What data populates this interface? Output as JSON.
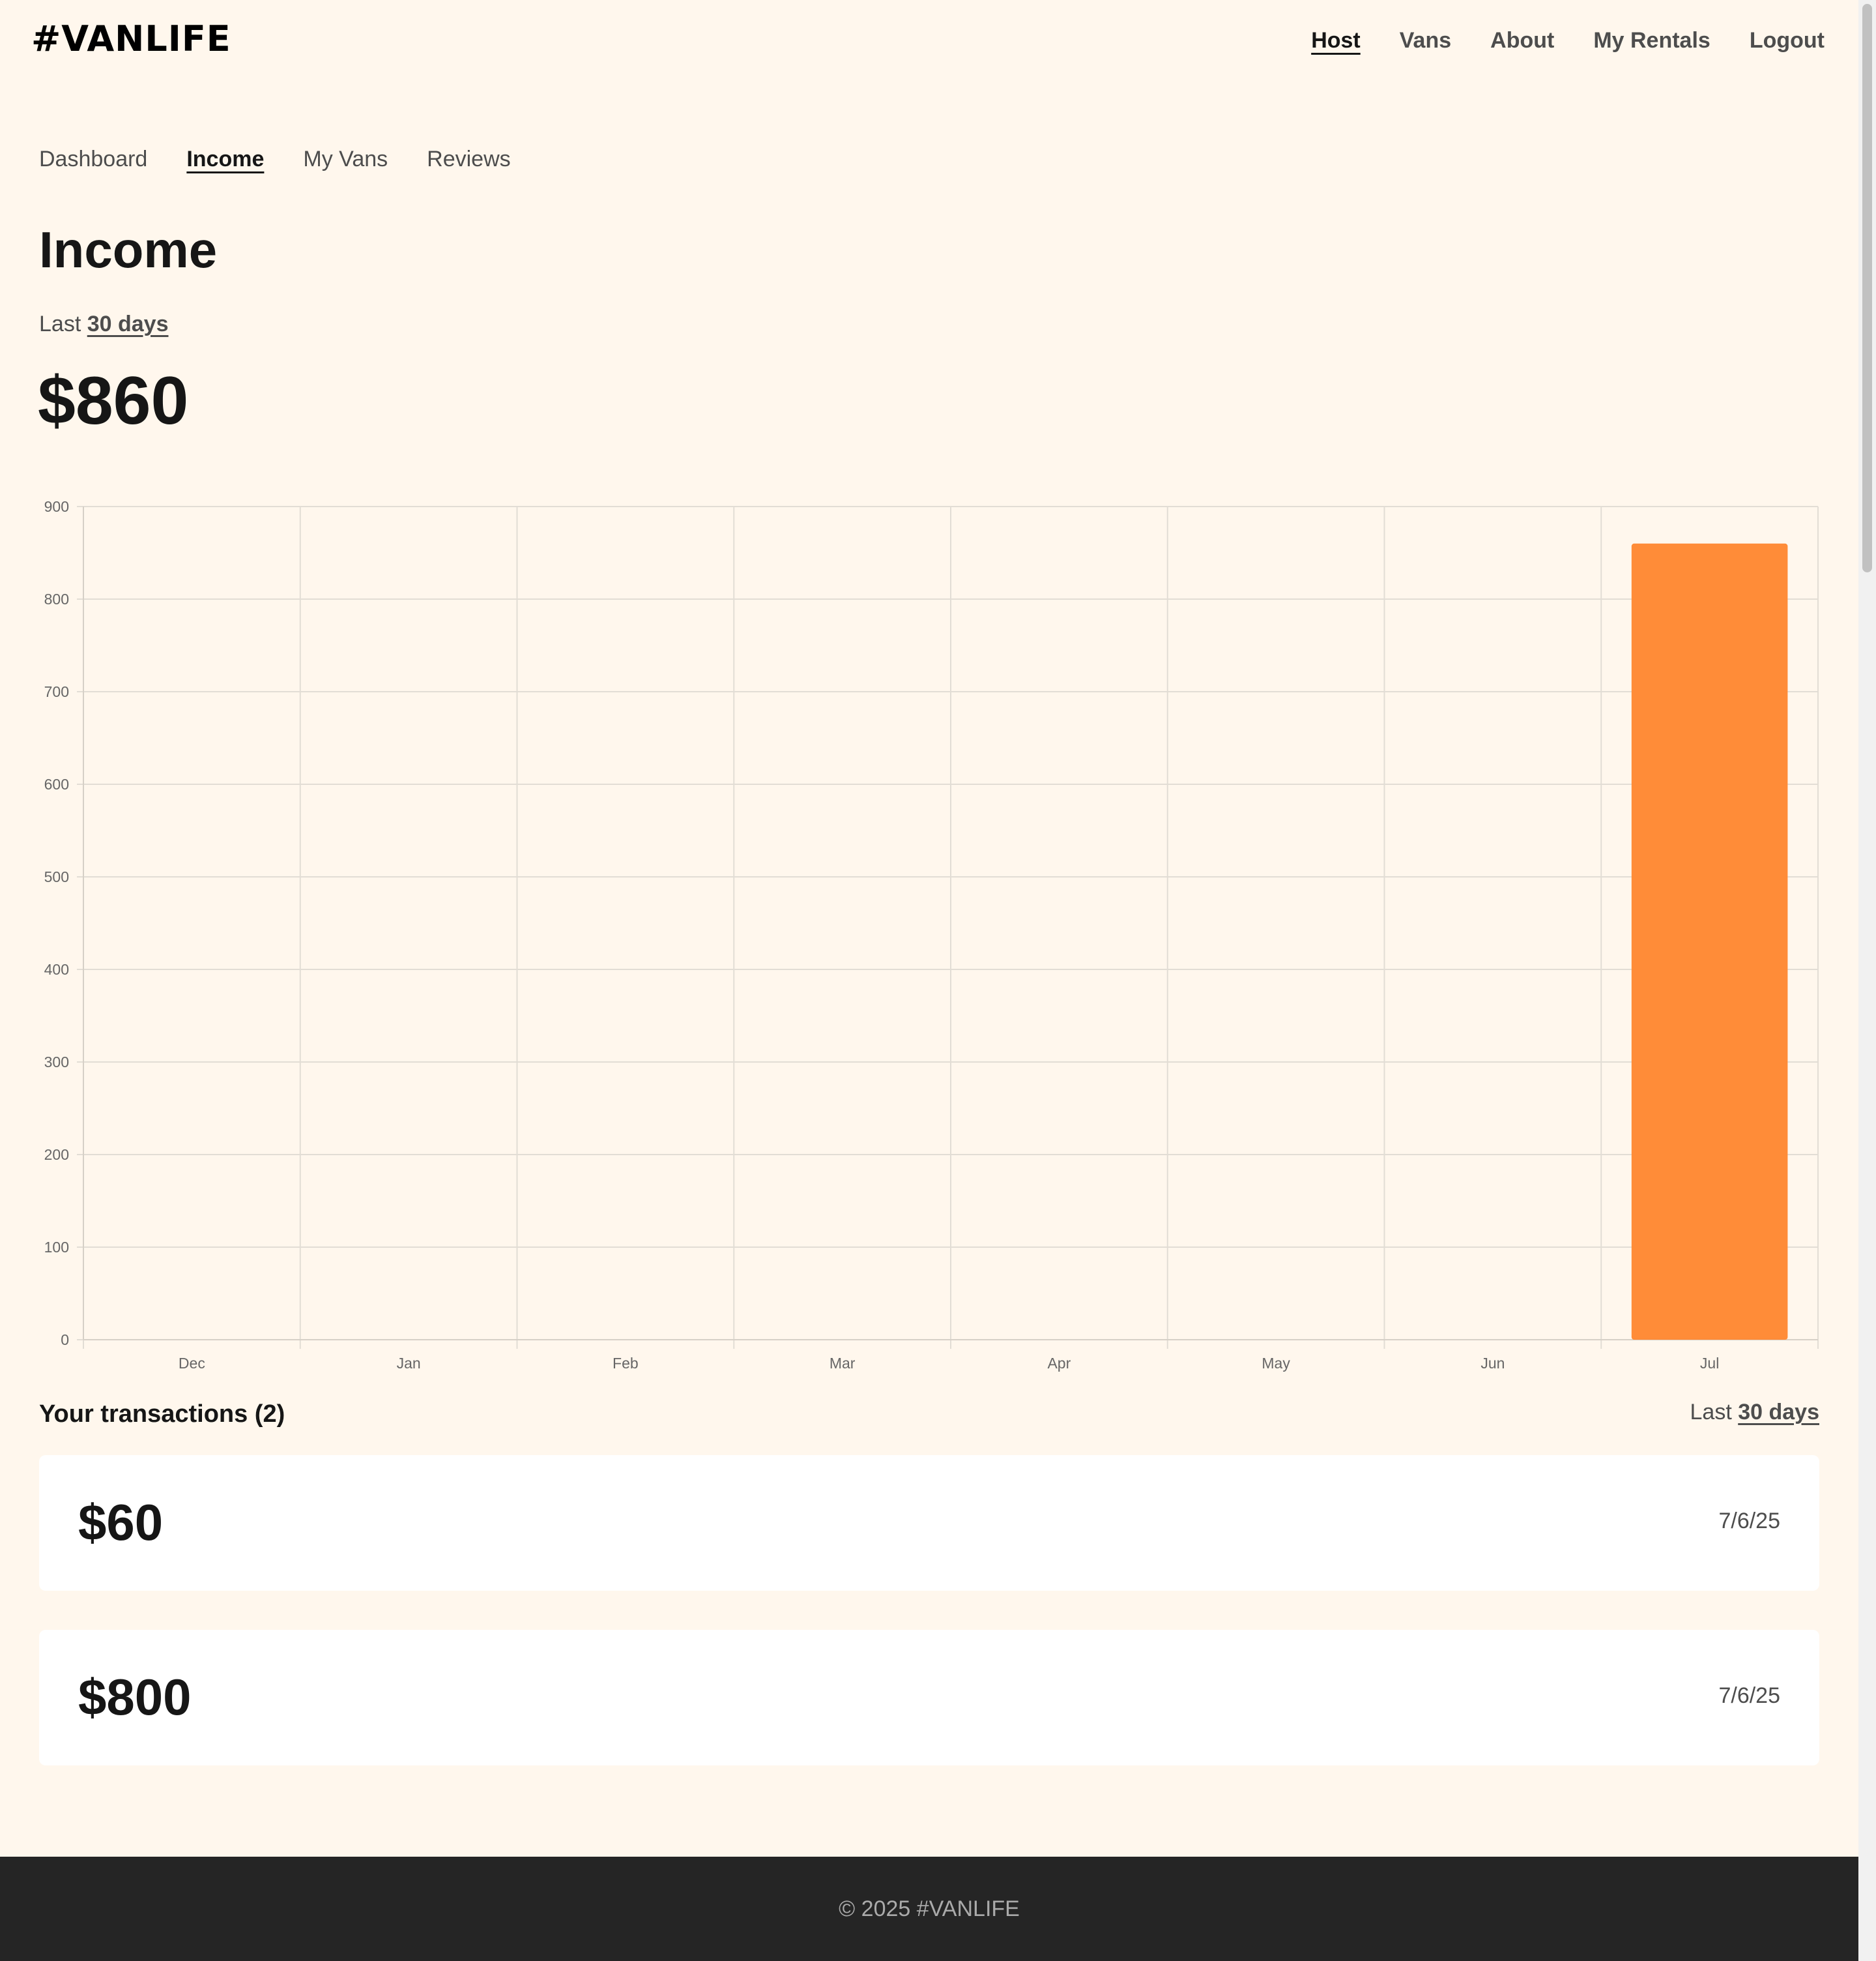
{
  "header": {
    "logo": "#VANLIFE",
    "nav": [
      {
        "label": "Host",
        "active": true
      },
      {
        "label": "Vans",
        "active": false
      },
      {
        "label": "About",
        "active": false
      },
      {
        "label": "My Rentals",
        "active": false
      },
      {
        "label": "Logout",
        "active": false
      }
    ]
  },
  "host_nav": [
    {
      "label": "Dashboard",
      "active": false
    },
    {
      "label": "Income",
      "active": true
    },
    {
      "label": "My Vans",
      "active": false
    },
    {
      "label": "Reviews",
      "active": false
    }
  ],
  "income": {
    "title": "Income",
    "period_prefix": "Last",
    "period_value": "30 days",
    "total": "$860"
  },
  "chart_data": {
    "type": "bar",
    "title": "",
    "xlabel": "",
    "ylabel": "",
    "categories": [
      "Dec",
      "Jan",
      "Feb",
      "Mar",
      "Apr",
      "May",
      "Jun",
      "Jul"
    ],
    "values": [
      0,
      0,
      0,
      0,
      0,
      0,
      0,
      860
    ],
    "ylim": [
      0,
      900
    ],
    "yticks": [
      "0",
      "100",
      "200",
      "300",
      "400",
      "500",
      "600",
      "700",
      "800",
      "900"
    ],
    "grid": true,
    "bar_color": "#FF8C38"
  },
  "transactions": {
    "title": "Your transactions (2)",
    "period_prefix": "Last",
    "period_value": "30 days",
    "items": [
      {
        "amount": "$60",
        "date": "7/6/25"
      },
      {
        "amount": "$800",
        "date": "7/6/25"
      }
    ]
  },
  "footer": {
    "text": "© 2025 #VANLIFE"
  },
  "colors": {
    "background": "#FFF7ED",
    "accent": "#FF8C38",
    "footer_bg": "#252525"
  }
}
